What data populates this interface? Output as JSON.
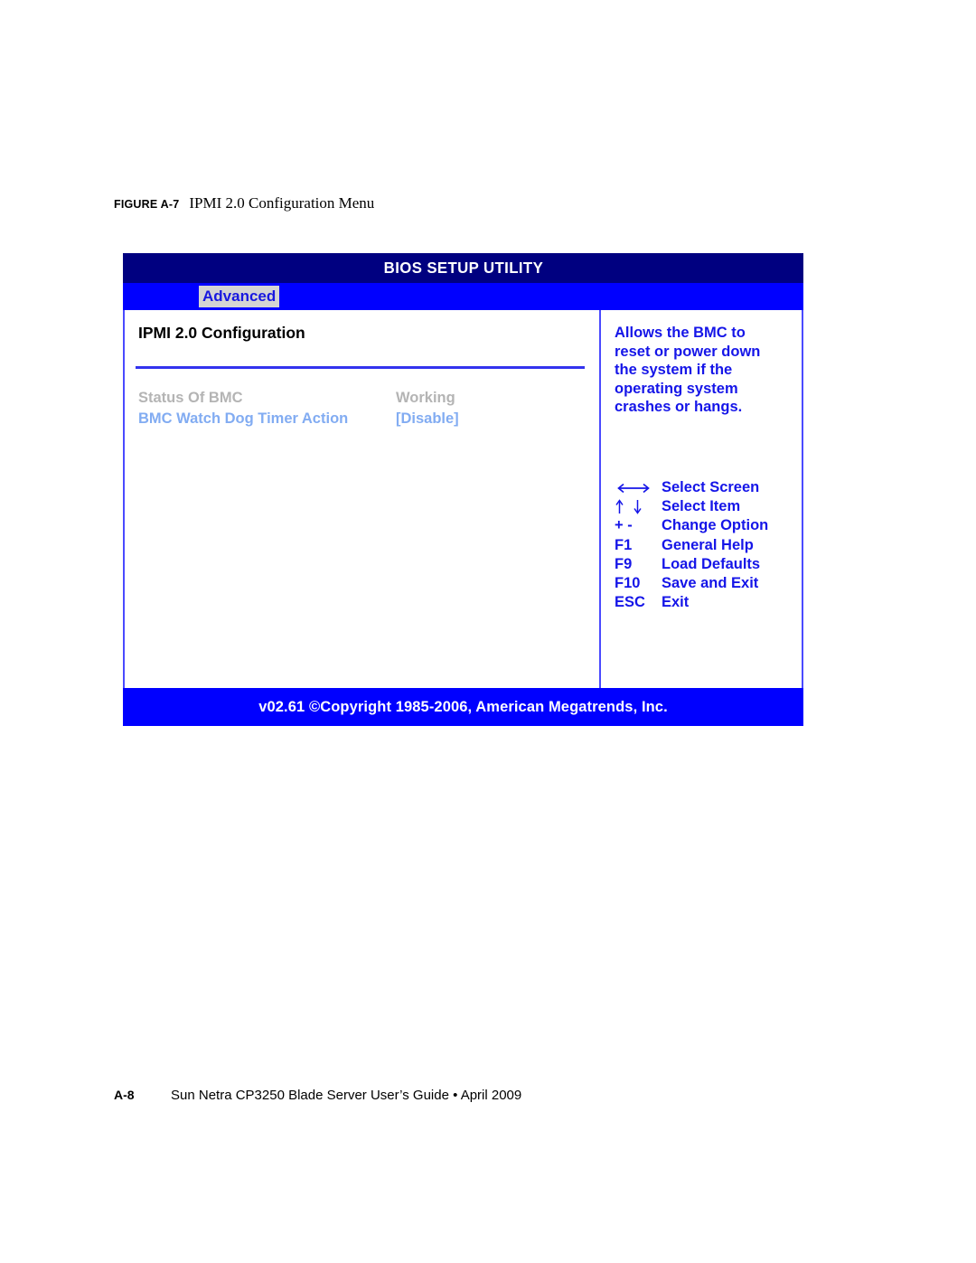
{
  "figure": {
    "label": "FIGURE A-7",
    "caption": "IPMI 2.0 Configuration Menu"
  },
  "bios": {
    "title": "BIOS SETUP UTILITY",
    "tabs": [
      {
        "label": "Advanced",
        "active": true
      }
    ],
    "section_title": "IPMI 2.0 Configuration",
    "settings": [
      {
        "label": "Status Of BMC",
        "value": "Working",
        "tone": "gray"
      },
      {
        "label": "BMC Watch Dog Timer Action",
        "value": "[Disable]",
        "tone": "blue"
      }
    ],
    "help": {
      "lines": [
        "Allows the BMC to",
        "reset or power down",
        "the system if the",
        "operating system",
        "crashes or hangs."
      ]
    },
    "keys": [
      {
        "icon": "left-right-arrow-icon",
        "key": "",
        "desc": "Select Screen"
      },
      {
        "icon": "up-down-arrow-icon",
        "key": "",
        "desc": "Select Item"
      },
      {
        "icon": "",
        "key": "+ -",
        "desc": "Change Option"
      },
      {
        "icon": "",
        "key": "F1",
        "desc": "General Help"
      },
      {
        "icon": "",
        "key": "F9",
        "desc": "Load Defaults"
      },
      {
        "icon": "",
        "key": "F10",
        "desc": "Save and Exit"
      },
      {
        "icon": "",
        "key": "ESC",
        "desc": "Exit"
      }
    ],
    "footer": "v02.61 ©Copyright 1985-2006, American Megatrends, Inc.",
    "colors": {
      "titlebar": "#000080",
      "tabbar": "#0000ff",
      "accent_blue": "#1515e8",
      "disabled_gray": "#b4b4b4",
      "value_blue": "#82acf2",
      "footer_bar": "#0000ff"
    }
  },
  "page_footer": {
    "page": "A-8",
    "text": "Sun Netra CP3250 Blade Server User’s Guide • April 2009"
  }
}
